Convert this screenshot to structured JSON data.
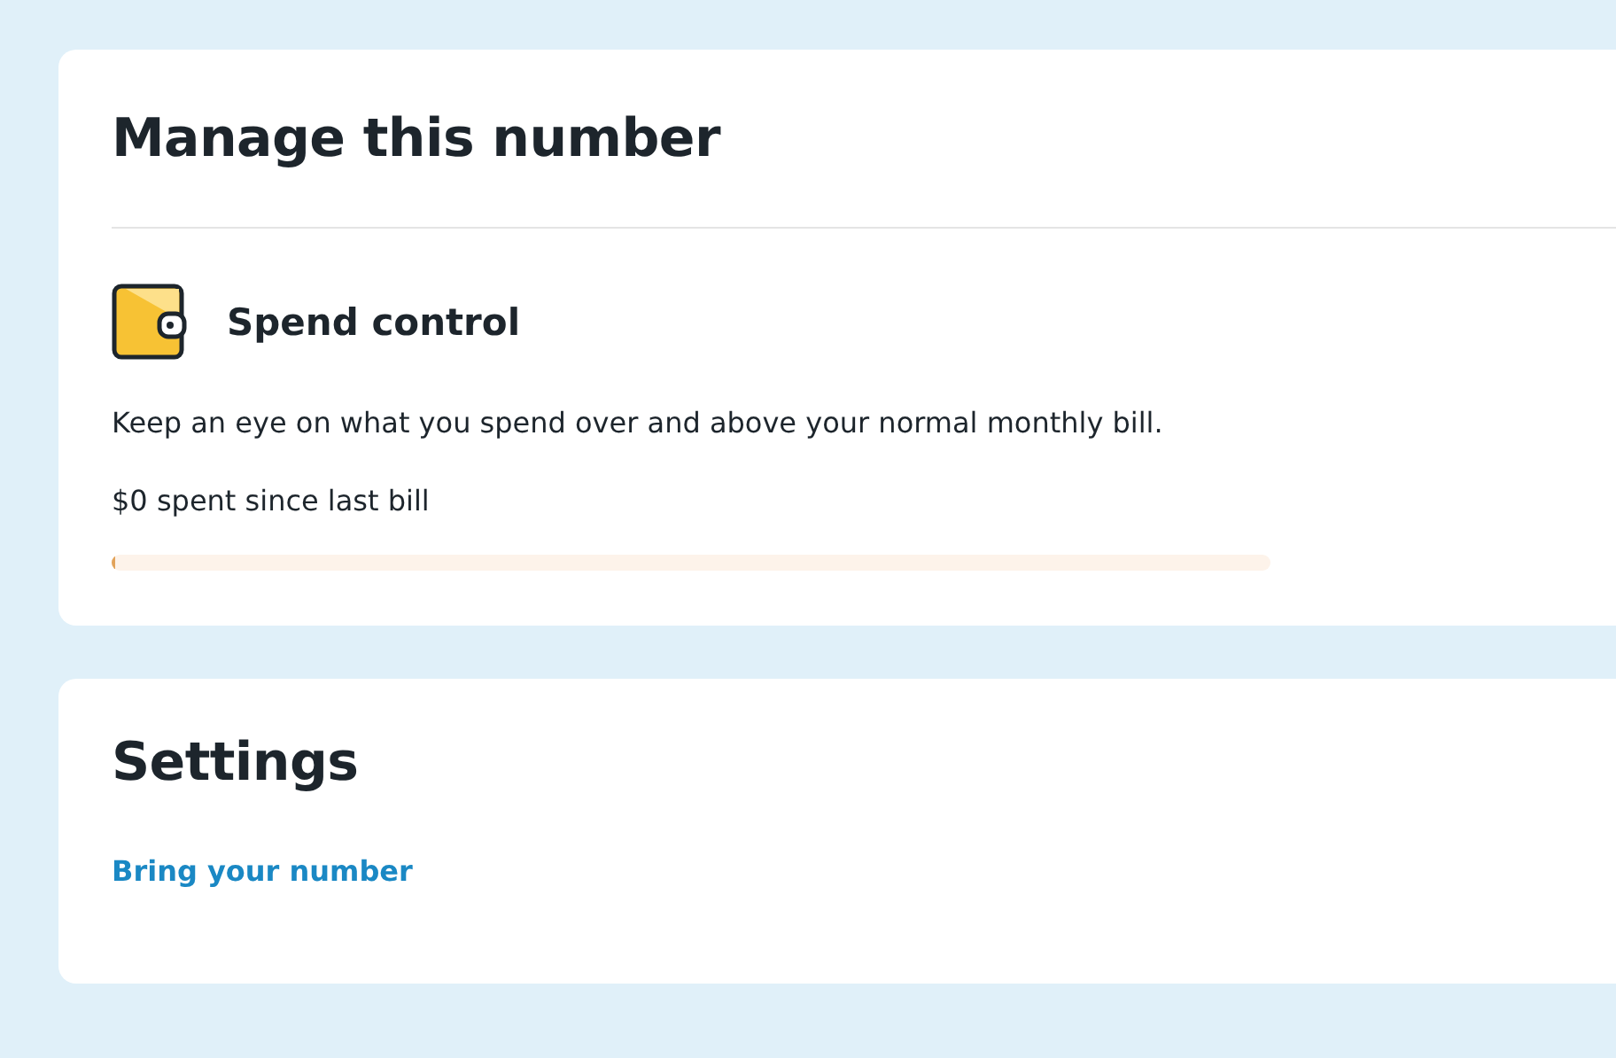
{
  "manage": {
    "title": "Manage this number",
    "spend_control": {
      "title": "Spend control",
      "description": "Keep an eye on what you spend over and above your normal monthly bill.",
      "spent": "$0 spent since last bill",
      "level": 0
    }
  },
  "settings": {
    "title": "Settings",
    "links": [
      "Bring your number"
    ]
  }
}
